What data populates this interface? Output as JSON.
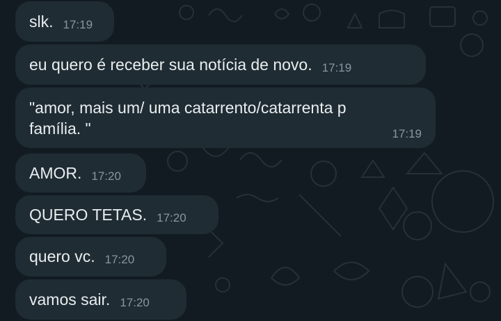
{
  "chat": {
    "background_color": "#121b22",
    "bubble_color": "#1f2c33",
    "text_color": "#e9edef",
    "time_color": "#8696a0",
    "messages": [
      {
        "text": "slk.",
        "time": "17:19"
      },
      {
        "text": "eu quero é receber sua notícia de novo.",
        "time": "17:19"
      },
      {
        "text": "\"amor, mais um/ uma catarrento/catarrenta p\nfamília. \"",
        "time": "17:19"
      },
      {
        "text": "AMOR.",
        "time": "17:20"
      },
      {
        "text": "QUERO TETAS.",
        "time": "17:20"
      },
      {
        "text": "quero vc.",
        "time": "17:20"
      },
      {
        "text": "vamos sair.",
        "time": "17:20"
      }
    ]
  }
}
